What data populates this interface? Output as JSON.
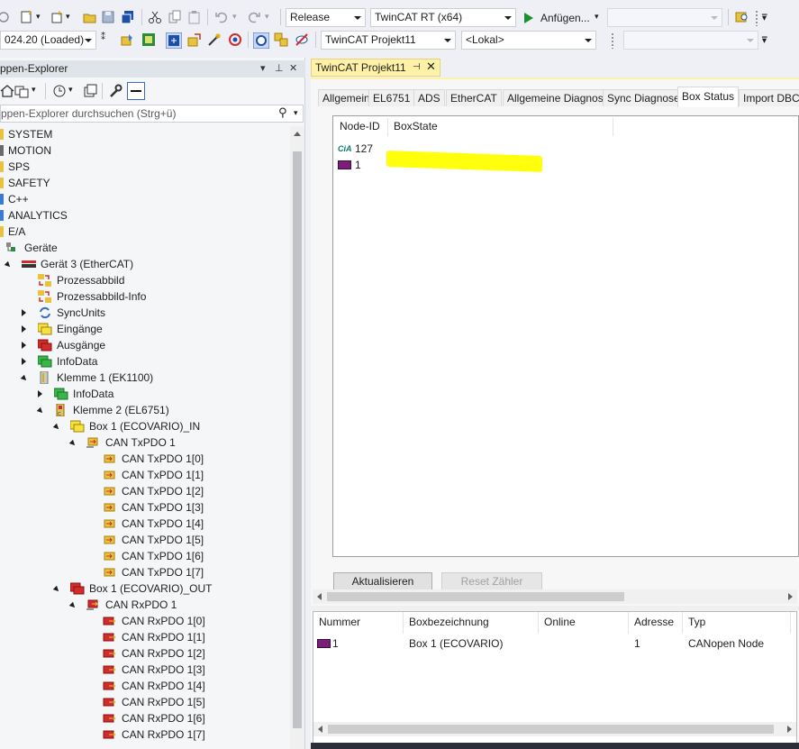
{
  "toolbar1": {
    "build_config": "Release",
    "target_platform": "TwinCAT RT (x64)",
    "attach_label": "Anfügen...",
    "empty_combo": ""
  },
  "toolbar2": {
    "version": "024.20 (Loaded)",
    "project": "TwinCAT Projekt11",
    "target": "<Lokal>",
    "empty_combo": ""
  },
  "explorer": {
    "title": "ppen-Explorer",
    "pin": "−⊟",
    "dropdown": "▾",
    "close": "✕",
    "search_placeholder": "ppen-Explorer durchsuchen (Strg+ü)",
    "tree": [
      {
        "label": "SYSTEM"
      },
      {
        "label": "MOTION"
      },
      {
        "label": "SPS"
      },
      {
        "label": "SAFETY"
      },
      {
        "label": "C++"
      },
      {
        "label": "ANALYTICS"
      },
      {
        "label": "E/A"
      },
      {
        "label": "Geräte"
      },
      {
        "label": "Gerät 3 (EtherCAT)"
      },
      {
        "label": "Prozessabbild"
      },
      {
        "label": "Prozessabbild-Info"
      },
      {
        "label": "SyncUnits"
      },
      {
        "label": "Eingänge"
      },
      {
        "label": "Ausgänge"
      },
      {
        "label": "InfoData"
      },
      {
        "label": "Klemme 1 (EK1100)"
      },
      {
        "label": "InfoData"
      },
      {
        "label": "Klemme 2 (EL6751)"
      },
      {
        "label": "Box 1 (ECOVARIO)_IN"
      },
      {
        "label": "CAN TxPDO 1"
      },
      {
        "label": "CAN TxPDO 1[0]"
      },
      {
        "label": "CAN TxPDO 1[1]"
      },
      {
        "label": "CAN TxPDO 1[2]"
      },
      {
        "label": "CAN TxPDO 1[3]"
      },
      {
        "label": "CAN TxPDO 1[4]"
      },
      {
        "label": "CAN TxPDO 1[5]"
      },
      {
        "label": "CAN TxPDO 1[6]"
      },
      {
        "label": "CAN TxPDO 1[7]"
      },
      {
        "label": "Box 1 (ECOVARIO)_OUT"
      },
      {
        "label": "CAN RxPDO 1"
      },
      {
        "label": "CAN RxPDO 1[0]"
      },
      {
        "label": "CAN RxPDO 1[1]"
      },
      {
        "label": "CAN RxPDO 1[2]"
      },
      {
        "label": "CAN RxPDO 1[3]"
      },
      {
        "label": "CAN RxPDO 1[4]"
      },
      {
        "label": "CAN RxPDO 1[5]"
      },
      {
        "label": "CAN RxPDO 1[6]"
      },
      {
        "label": "CAN RxPDO 1[7]"
      }
    ]
  },
  "document": {
    "tab_title": "TwinCAT Projekt11",
    "tab_pin": "⊣",
    "tab_close": "✕",
    "tabs": [
      {
        "label": "Allgemein"
      },
      {
        "label": "EL6751"
      },
      {
        "label": "ADS"
      },
      {
        "label": "EtherCAT"
      },
      {
        "label": "Allgemeine Diagnose"
      },
      {
        "label": "Sync Diagnose"
      },
      {
        "label": "Box Status"
      },
      {
        "label": "Import DBC"
      }
    ],
    "active_tab": "Box Status",
    "box_status": {
      "columns": [
        "Node-ID",
        "BoxState"
      ],
      "rows": [
        {
          "icon": "cia-icon",
          "node_id": "127",
          "box_state": ""
        },
        {
          "icon": "box-device-icon",
          "node_id": "1",
          "box_state": ""
        }
      ],
      "highlight_color": "#ffff00"
    },
    "buttons": {
      "refresh": "Aktualisieren",
      "reset": "Reset Zähler"
    },
    "box_list": {
      "columns": [
        "Nummer",
        "Boxbezeichnung",
        "Online",
        "Adresse",
        "Typ"
      ],
      "rows": [
        {
          "number": "1",
          "name": "Box 1 (ECOVARIO)",
          "online": "",
          "address": "1",
          "type": "CANopen Node"
        }
      ]
    }
  },
  "colors": {
    "accent_tab": "#fff1a6",
    "folder_yellow": "#e8c33b",
    "input_green": "#39b54a",
    "output_red": "#d02c2c",
    "device_purple": "#7a1e7a"
  }
}
